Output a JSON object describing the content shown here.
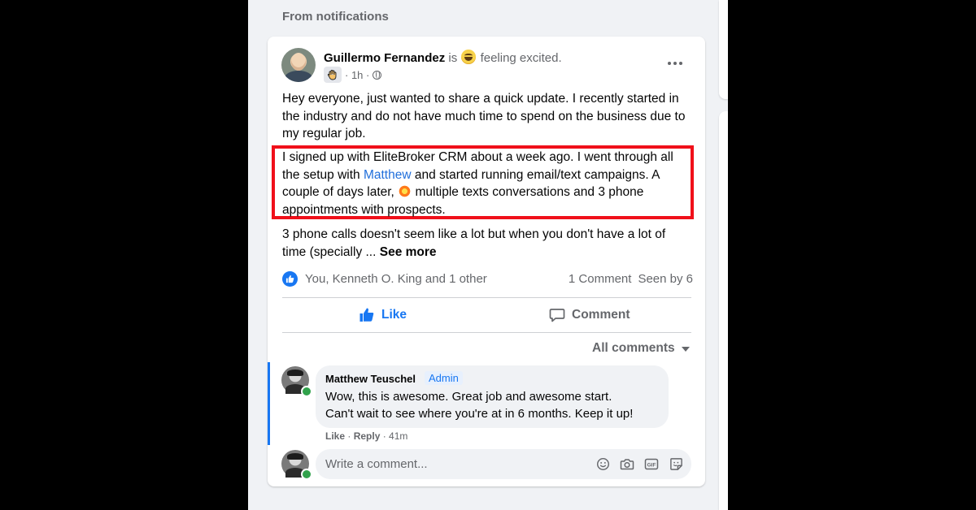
{
  "section": {
    "title": "From notifications"
  },
  "post": {
    "author": "Guillermo Fernandez",
    "status_prefix": "is",
    "status_emoji": "grinning-face",
    "feeling": "feeling excited.",
    "badge_emoji": "waving-hand",
    "time": "1h",
    "privacy_icon": "globe-icon",
    "paragraph1": "Hey everyone, just wanted to share a quick update. I recently started in the industry and do not have much time to spend on the business due to my regular job.",
    "paragraph2_a": "I signed up with EliteBroker CRM about a week ago. I went through all the setup with ",
    "mention": "Matthew",
    "paragraph2_b": " and started running email/text campaigns. A couple of days later, ",
    "paragraph2_c": " multiple texts conversations and 3 phone appointments with prospects.",
    "paragraph3": "3 phone calls doesn't seem like a lot but when you don't have a lot of time (specially ... ",
    "see_more": "See more",
    "highlight_color": "#f0101a"
  },
  "reactions": {
    "reactors": "You, Kenneth O. King and 1 other",
    "comments_count": "1 Comment",
    "seen_by": "Seen by 6"
  },
  "actions": {
    "like": "Like",
    "comment": "Comment"
  },
  "comments_filter": {
    "label": "All comments"
  },
  "comment": {
    "author": "Matthew Teuschel",
    "badge": "Admin",
    "text_line1": "Wow, this is awesome. Great job and awesome start.",
    "text_line2": "Can't wait to see where you're at in 6 months. Keep it up!",
    "like": "Like",
    "reply": "Reply",
    "time": "41m"
  },
  "composer": {
    "placeholder": "Write a comment...",
    "icons": [
      "emoji-icon",
      "camera-icon",
      "gif-icon",
      "sticker-icon"
    ]
  },
  "colors": {
    "accent": "#1877f2",
    "online": "#31a24c",
    "panel_bg": "#f0f2f5"
  }
}
